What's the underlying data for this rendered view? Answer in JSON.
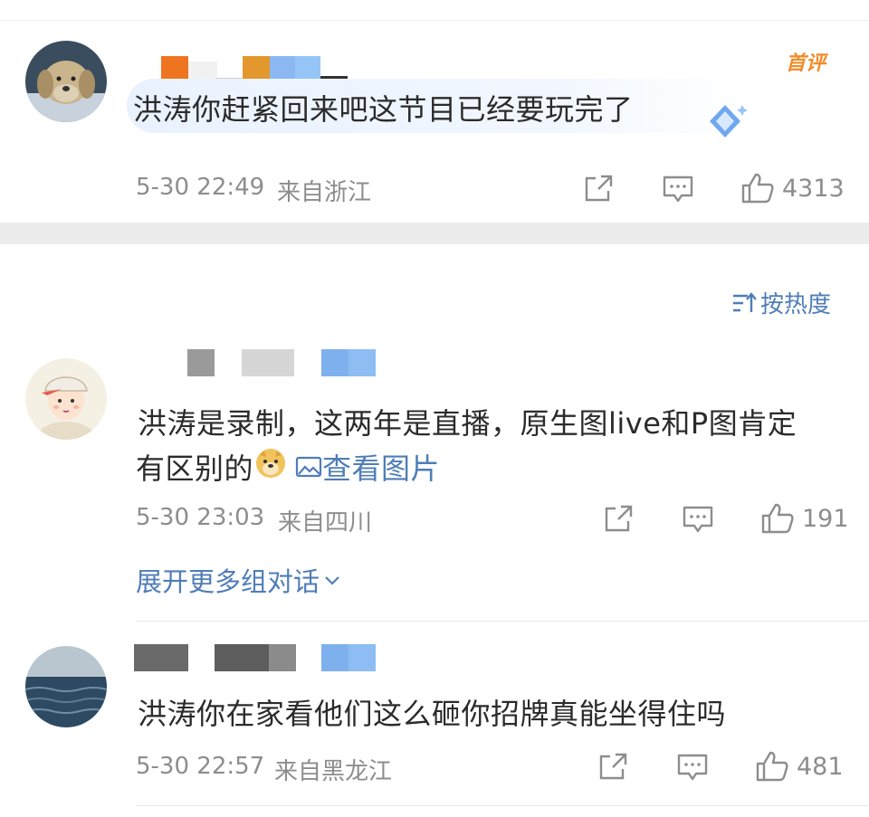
{
  "colors": {
    "link": "#4f7db8",
    "meta": "#8d8d8d",
    "badge": "#f08c2a",
    "band": "#ececec"
  },
  "first_comment": {
    "text": "洪涛你赶紧回来吧这节目已经要玩完了",
    "badge": "首评",
    "time": "5-30 22:49",
    "location": "来自浙江",
    "likes": "4313",
    "icons": [
      "share-icon",
      "comment-icon",
      "like-icon"
    ]
  },
  "sort": {
    "label": "按热度",
    "icon": "sort-icon"
  },
  "comments": [
    {
      "line1": "洪涛是录制，这两年是直播，原生图live和P图肯定",
      "line2_text": "有区别的",
      "emoji": "doge-emoji",
      "view_image": "查看图片",
      "time": "5-30 23:03",
      "location": "来自四川",
      "likes": "191",
      "expand": "展开更多组对话"
    },
    {
      "text": "洪涛你在家看他们这么砸你招牌真能坐得住吗",
      "time": "5-30 22:57",
      "location": "来自黑龙江",
      "likes": "481"
    }
  ]
}
